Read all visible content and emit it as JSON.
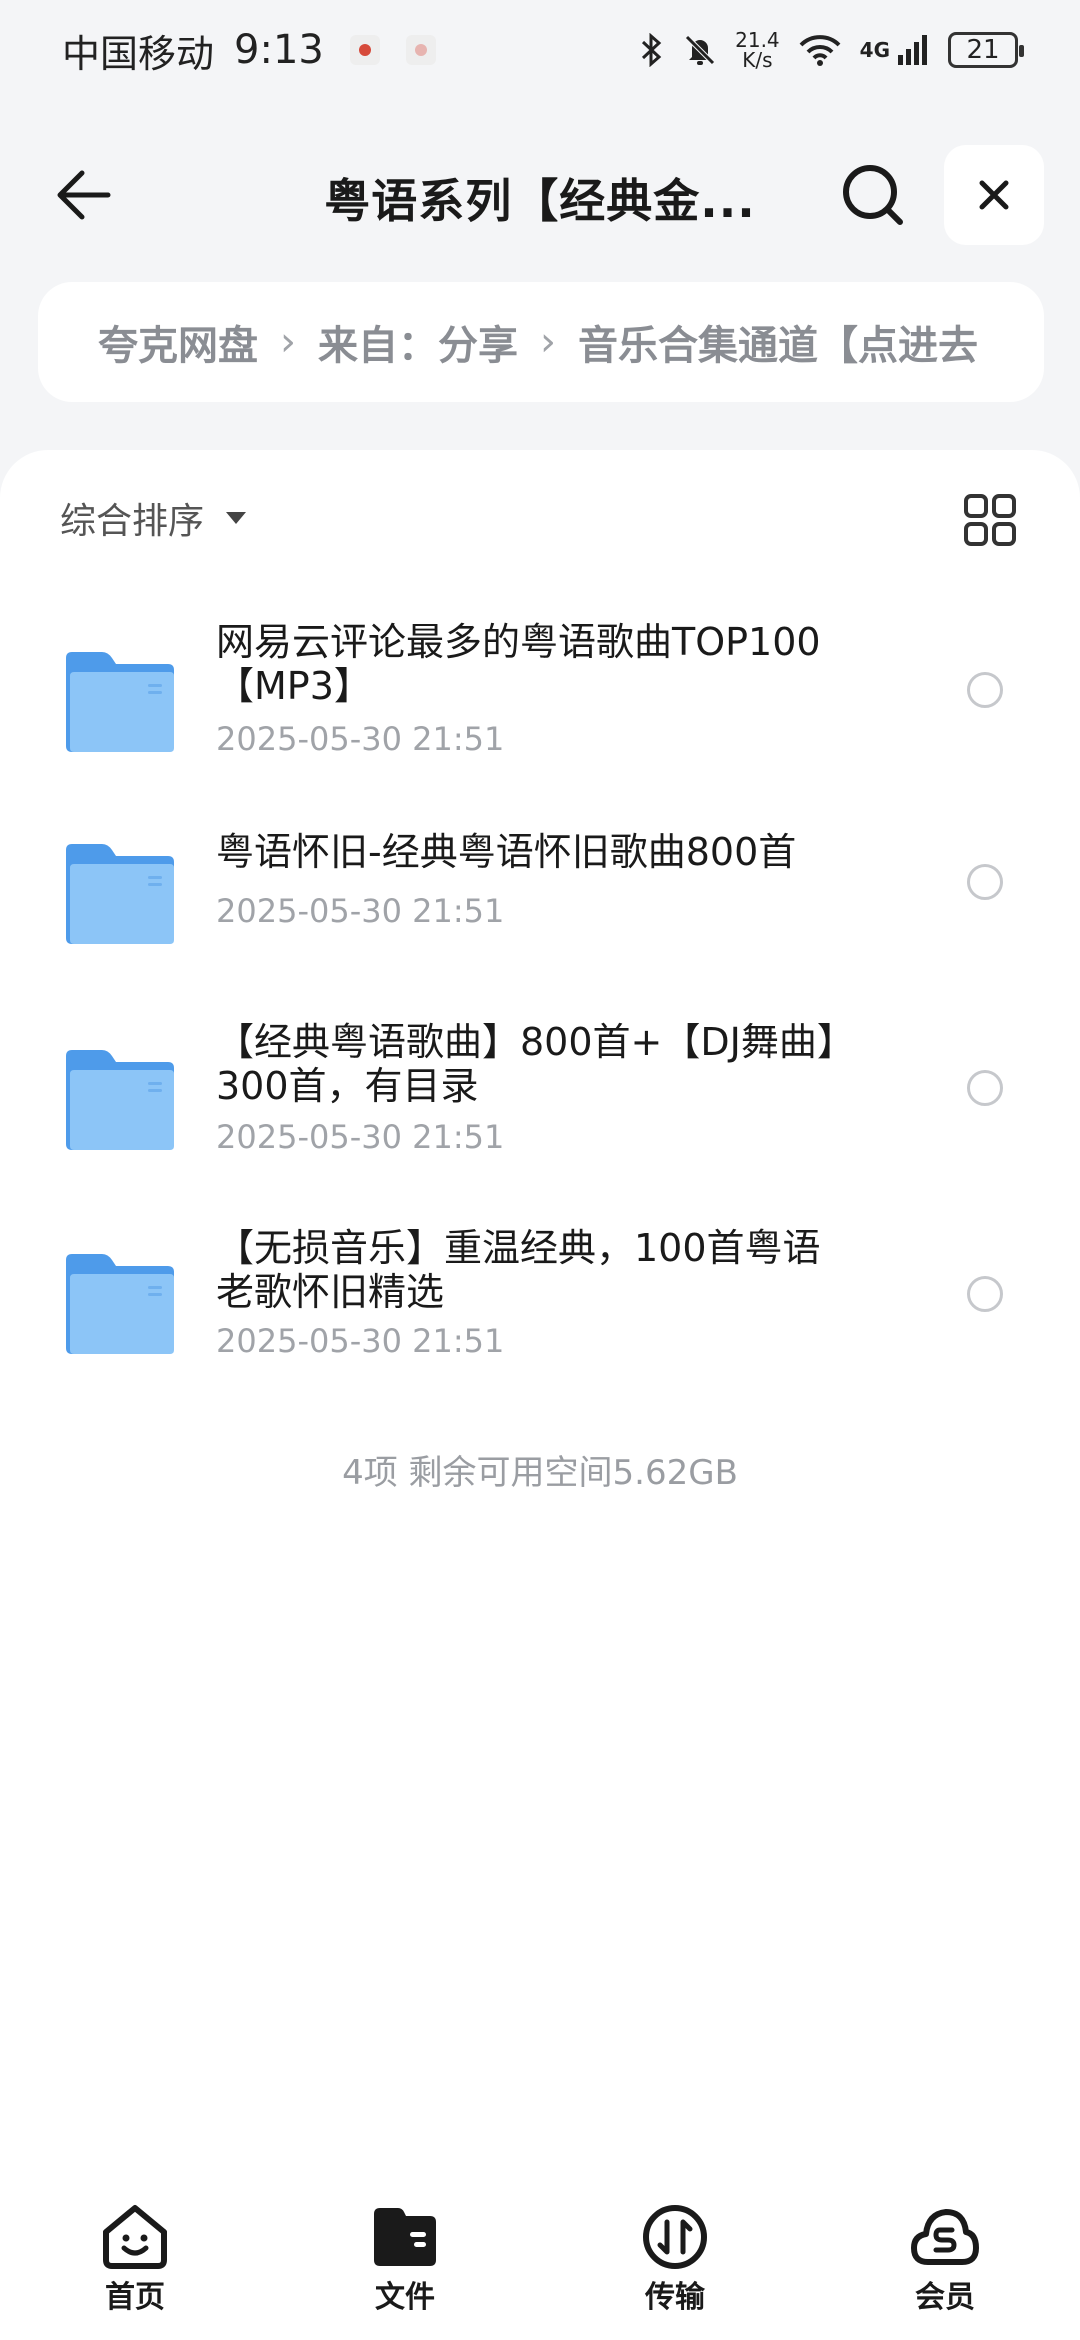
{
  "status_bar": {
    "carrier": "中国移动",
    "time": "9:13",
    "speed_value": "21.4",
    "speed_unit": "K/s",
    "network": "4G",
    "battery": "21"
  },
  "header": {
    "title": "粤语系列【经典金..."
  },
  "breadcrumb": {
    "items": [
      "夸克网盘",
      "来自：分享",
      "音乐合集通道【点进去"
    ]
  },
  "toolbar": {
    "sort_label": "综合排序"
  },
  "files": [
    {
      "name": "网易云评论最多的粤语歌曲TOP100【MP3】",
      "date": "2025-05-30 21:51"
    },
    {
      "name": "粤语怀旧-经典粤语怀旧歌曲800首",
      "date": "2025-05-30 21:51"
    },
    {
      "name": "【经典粤语歌曲】800首+【DJ舞曲】300首，有目录",
      "date": "2025-05-30 21:51"
    },
    {
      "name": "【无损音乐】重温经典，100首粤语老歌怀旧精选",
      "date": "2025-05-30 21:51"
    }
  ],
  "summary": "4项 剩余可用空间5.62GB",
  "tabs": [
    {
      "label": "首页",
      "icon": "smile-home-icon"
    },
    {
      "label": "文件",
      "icon": "folder-tab-icon"
    },
    {
      "label": "传输",
      "icon": "transfer-icon"
    },
    {
      "label": "会员",
      "icon": "vip-cloud-icon"
    }
  ],
  "colors": {
    "folder_back": "#4e9bea",
    "folder_front": "#8cc5f7",
    "accent_text": "#1a1a1a",
    "muted_text": "#a0a3a8"
  }
}
